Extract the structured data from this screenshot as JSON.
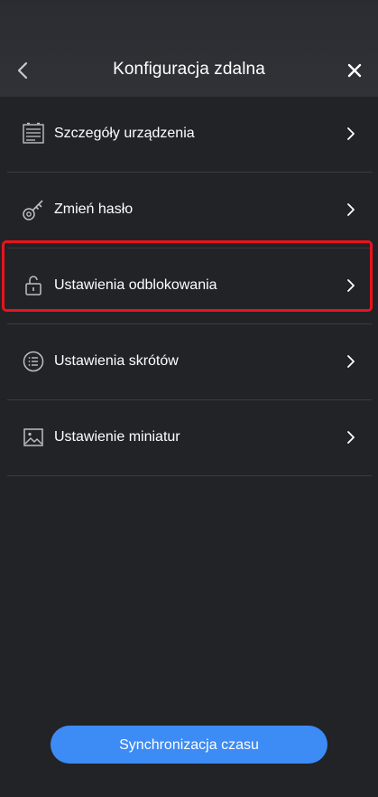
{
  "header": {
    "title": "Konfiguracja zdalna",
    "back_icon": "back-arrow-icon",
    "close_icon": "close-icon"
  },
  "menu": {
    "items": [
      {
        "label": "Szczegóły urządzenia",
        "icon": "device-details-icon"
      },
      {
        "label": "Zmień hasło",
        "icon": "key-icon"
      },
      {
        "label": "Ustawienia odblokowania",
        "icon": "unlock-icon"
      },
      {
        "label": "Ustawienia skrótów",
        "icon": "shortcut-list-icon"
      },
      {
        "label": "Ustawienie miniatur",
        "icon": "image-icon"
      }
    ],
    "highlighted_index": 2
  },
  "footer": {
    "sync_label": "Synchronizacja czasu"
  },
  "colors": {
    "background": "#222327",
    "header": "#2e2f34",
    "divider": "#3a3b40",
    "accent": "#3d8bf5",
    "highlight": "#e8141b"
  }
}
